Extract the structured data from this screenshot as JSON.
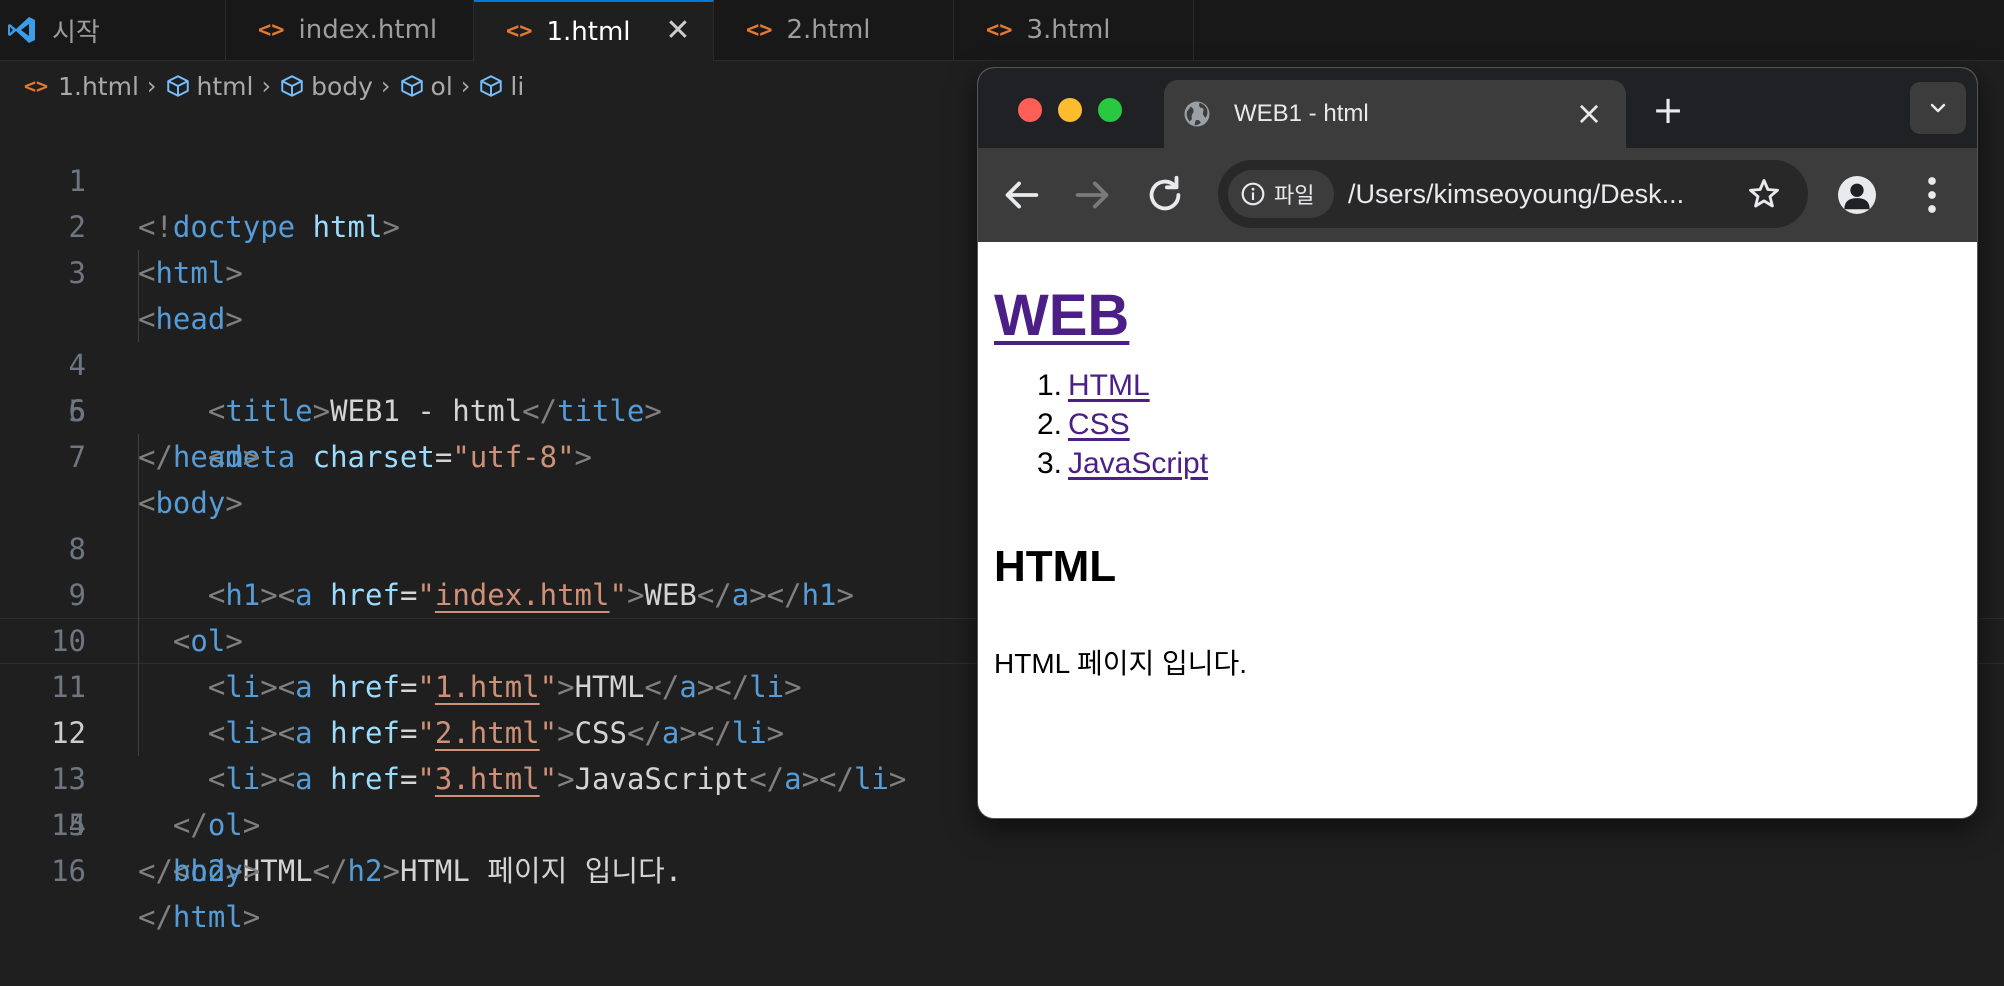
{
  "editor": {
    "tabs": [
      {
        "label": "시작",
        "icon": "vscode-icon",
        "active": false
      },
      {
        "label": "index.html",
        "icon": "html-file-icon",
        "active": false
      },
      {
        "label": "1.html",
        "icon": "html-file-icon",
        "active": true
      },
      {
        "label": "2.html",
        "icon": "html-file-icon",
        "active": false
      },
      {
        "label": "3.html",
        "icon": "html-file-icon",
        "active": false
      }
    ],
    "breadcrumb": [
      "1.html",
      "html",
      "body",
      "ol",
      "li"
    ],
    "current_line": 12,
    "line_numbers": [
      "1",
      "2",
      "3",
      "4",
      "5",
      "6",
      "7",
      "8",
      "9",
      "10",
      "11",
      "12",
      "13",
      "14",
      "15",
      "16"
    ],
    "code": {
      "l1": {
        "a": "<!",
        "b": "doctype",
        "c": " html",
        "d": ">"
      },
      "l2": {
        "a": "<",
        "b": "html",
        "c": ">"
      },
      "l3": {
        "a": "<",
        "b": "head",
        "c": ">"
      },
      "l4": {
        "a": "<",
        "b": "title",
        "c": ">",
        "d": "WEB1 - html",
        "e": "</",
        "f": "title",
        "g": ">"
      },
      "l5": {
        "a": "<",
        "b": "meta",
        "c": " charset",
        "d": "=",
        "e": "\"utf-8\"",
        "f": ">"
      },
      "l6": {
        "a": "</",
        "b": "head",
        "c": ">"
      },
      "l7": {
        "a": "<",
        "b": "body",
        "c": ">"
      },
      "l8": {
        "a": "<",
        "b": "h1",
        "c": "><",
        "d": "a",
        "e": " href",
        "f": "=",
        "g": "\"",
        "h": "index.html",
        "i": "\"",
        "j": ">",
        "k": "WEB",
        "l": "</",
        "m": "a",
        "n": "></",
        "o": "h1",
        "p": ">"
      },
      "l9": {
        "a": "<",
        "b": "ol",
        "c": ">"
      },
      "l10": {
        "a": "<",
        "b": "li",
        "c": "><",
        "d": "a",
        "e": " href",
        "f": "=",
        "g": "\"",
        "h": "1.html",
        "i": "\"",
        "j": ">",
        "k": "HTML",
        "l": "</",
        "m": "a",
        "n": "></",
        "o": "li",
        "p": ">"
      },
      "l11": {
        "a": "<",
        "b": "li",
        "c": "><",
        "d": "a",
        "e": " href",
        "f": "=",
        "g": "\"",
        "h": "2.html",
        "i": "\"",
        "j": ">",
        "k": "CSS",
        "l": "</",
        "m": "a",
        "n": "></",
        "o": "li",
        "p": ">"
      },
      "l12": {
        "a": "<",
        "b": "li",
        "c": "><",
        "d": "a",
        "e": " href",
        "f": "=",
        "g": "\"",
        "h": "3.html",
        "i": "\"",
        "j": ">",
        "k": "JavaScript",
        "l": "</",
        "m": "a",
        "n": "></",
        "o": "li",
        "p": ">"
      },
      "l13": {
        "a": "</",
        "b": "ol",
        "c": ">"
      },
      "l14": {
        "a": "<",
        "b": "h2",
        "c": ">",
        "d": "HTML",
        "e": "</",
        "f": "h2",
        "g": ">",
        "h": "HTML 페이지 입니다."
      },
      "l15": {
        "a": "</",
        "b": "body",
        "c": ">"
      },
      "l16": {
        "a": "</",
        "b": "html",
        "c": ">"
      }
    }
  },
  "browser": {
    "tab_title": "WEB1 - html",
    "new_tab": "+",
    "site_info_chip": "파일",
    "address": "/Users/kimseoyoung/Desk...",
    "page": {
      "h1": "WEB",
      "list": [
        {
          "num": "1.",
          "label": "HTML"
        },
        {
          "num": "2.",
          "label": "CSS"
        },
        {
          "num": "3.",
          "label": "JavaScript"
        }
      ],
      "h2": "HTML",
      "paragraph": "HTML 페이지 입니다."
    }
  },
  "colors": {
    "editor_bg": "#1f1f1f",
    "tag": "#569cd6",
    "attribute": "#9cdcfe",
    "string": "#ce9178",
    "link_visited": "#4b1f86",
    "traffic_red": "#ff5f57",
    "traffic_yellow": "#febc2e",
    "traffic_green": "#28c840"
  }
}
